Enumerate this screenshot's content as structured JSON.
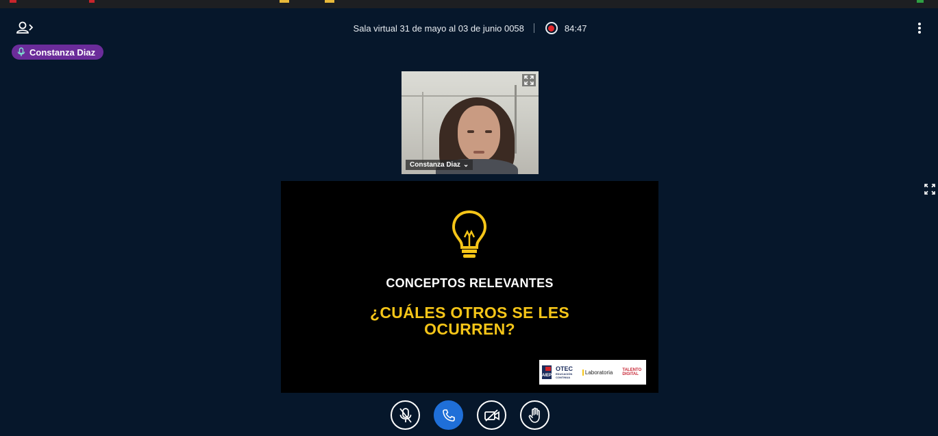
{
  "header": {
    "meeting_title": "Sala virtual 31 de mayo al 03 de junio 0058",
    "recording_time": "84:47"
  },
  "talker": {
    "name": "Constanza Diaz"
  },
  "webcam": {
    "name": "Constanza Diaz"
  },
  "slide": {
    "heading": "CONCEPTOS RELEVANTES",
    "question": "¿CUÁLES OTROS SE LES OCURREN?",
    "logos": {
      "aiep": "AIEP",
      "otec": "OTEC",
      "otec_sub": "EDUCACIÓN CONTINUA",
      "lab": "Laboratoria",
      "talento": "TALENTO DIGITAL"
    }
  },
  "colors": {
    "background": "#06172b",
    "talker_badge": "#6b2c9a",
    "recording": "#e3262a",
    "active_button": "#1f6fd8",
    "slide_accent": "#f5c518"
  },
  "icons": {
    "users_toggle": "user-arrow-icon",
    "options": "vertical-dots-icon",
    "mic": "mic-muted-icon",
    "phone": "phone-icon",
    "camera": "camera-off-icon",
    "hand": "raise-hand-icon",
    "expand": "fullscreen-icon",
    "bulb": "lightbulb-icon"
  }
}
